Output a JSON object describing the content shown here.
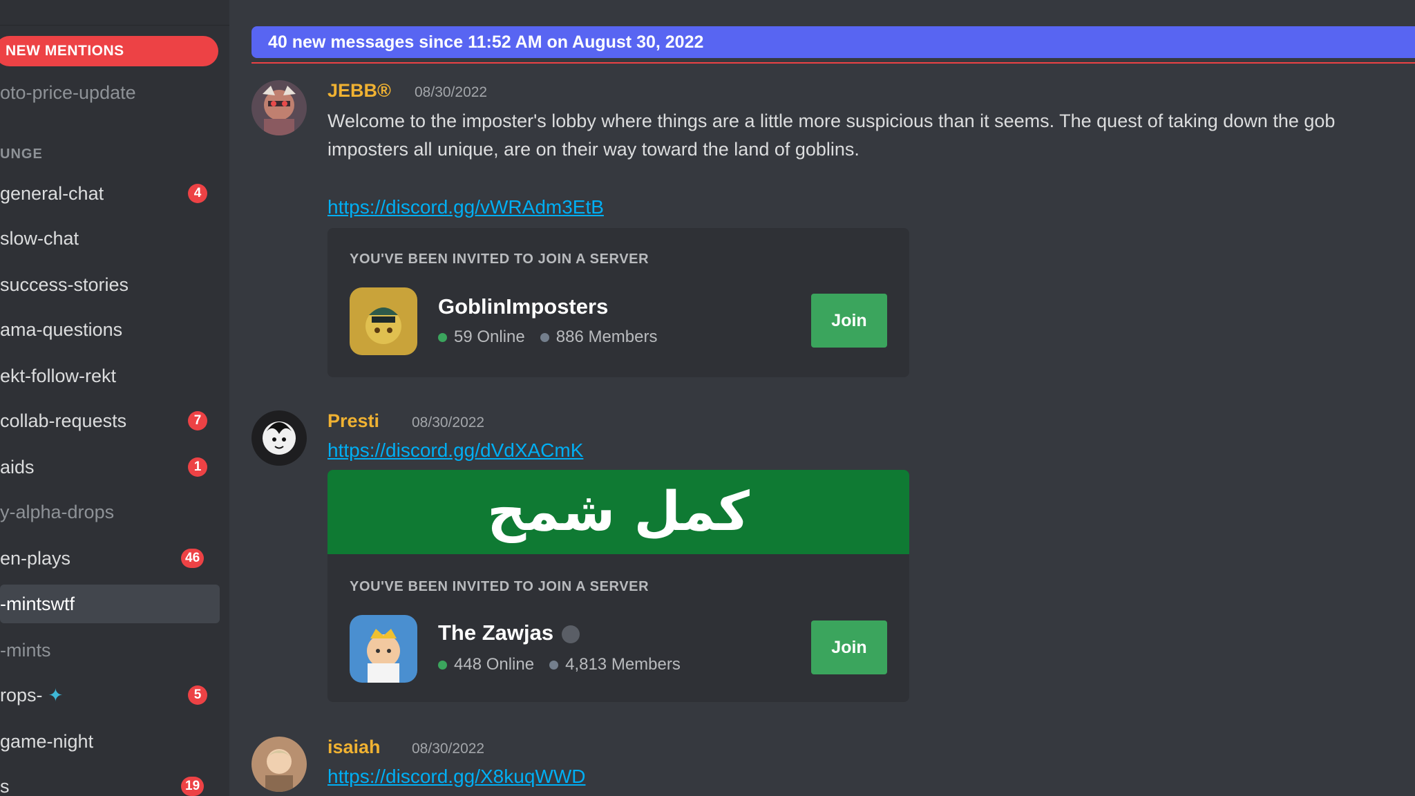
{
  "sidebar": {
    "new_mentions": "NEW MENTIONS",
    "channels_top": [
      {
        "name": "oto-price-update"
      }
    ],
    "section_header": "UNGE",
    "channels": [
      {
        "name": "general-chat",
        "badge": "4"
      },
      {
        "name": "slow-chat",
        "badge": ""
      },
      {
        "name": "success-stories",
        "badge": ""
      },
      {
        "name": "ama-questions",
        "badge": ""
      },
      {
        "name": "ekt-follow-rekt",
        "badge": ""
      },
      {
        "name": "collab-requests",
        "badge": "7"
      },
      {
        "name": "aids",
        "badge": "1"
      },
      {
        "name": "y-alpha-drops",
        "badge": ""
      },
      {
        "name": "en-plays",
        "badge": "46"
      },
      {
        "name": "-mintswtf",
        "badge": ""
      },
      {
        "name": "-mints",
        "badge": ""
      },
      {
        "name": "rops-",
        "badge": "5"
      },
      {
        "name": "game-night",
        "badge": ""
      },
      {
        "name": "s",
        "badge": "19"
      }
    ]
  },
  "main": {
    "new_messages_banner": "40 new messages since 11:52 AM on August 30, 2022",
    "messages": [
      {
        "username": "JEBB®",
        "timestamp": "08/30/2022",
        "text_line1": "Welcome to the imposter's lobby where things are a little more suspicious than it seems. The quest of taking down the gob",
        "text_line2": "imposters all unique, are on their way toward the land of goblins.",
        "link": "https://discord.gg/vWRAdm3EtB",
        "invite": {
          "header": "YOU'VE BEEN INVITED TO JOIN A SERVER",
          "server_name": "GoblinImposters",
          "online": "59 Online",
          "members": "886 Members",
          "join_label": "Join"
        }
      },
      {
        "username": "Presti",
        "timestamp": "08/30/2022",
        "link": "https://discord.gg/dVdXACmK",
        "banner_text": "كمل شمح",
        "invite": {
          "header": "YOU'VE BEEN INVITED TO JOIN A SERVER",
          "server_name": "The Zawjas",
          "online": "448 Online",
          "members": "4,813 Members",
          "join_label": "Join"
        }
      },
      {
        "username": "isaiah",
        "timestamp": "08/30/2022",
        "link": "https://discord.gg/X8kuqWWD"
      }
    ]
  },
  "colors": {
    "background": "#36393f",
    "sidebar": "#2f3136",
    "blurple": "#5865f2",
    "mention_red": "#ed4245",
    "username_gold": "#f0b232",
    "link_blue": "#00aff4",
    "join_green": "#3ba55d"
  },
  "icons": [
    "diamond-gem-icon",
    "verified-badge-icon",
    "online-dot-icon",
    "members-dot-icon"
  ]
}
